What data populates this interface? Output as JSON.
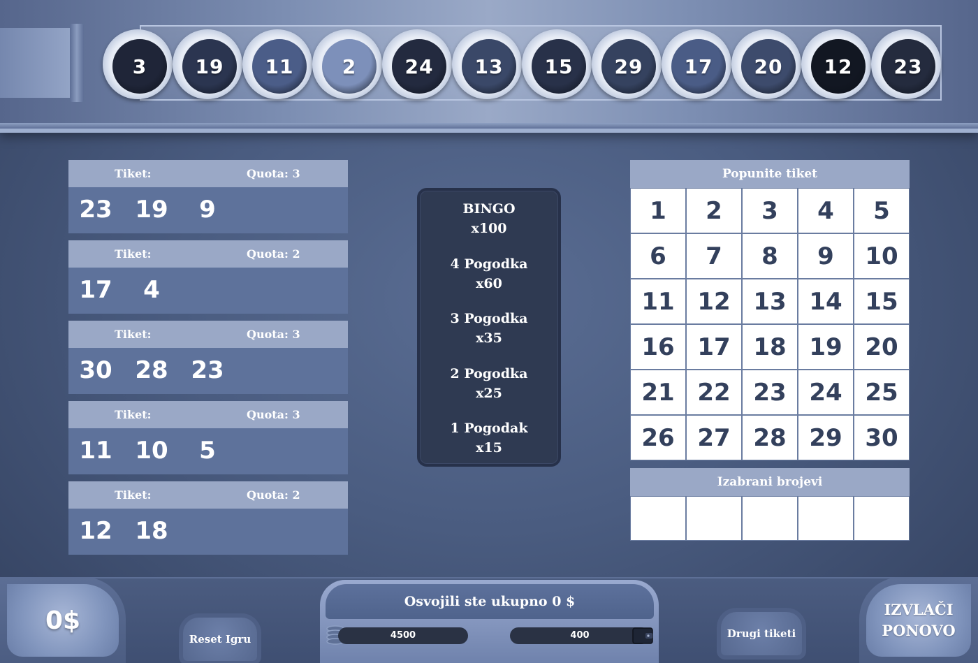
{
  "drawn_balls": [
    {
      "number": "3",
      "color": "#1f2538"
    },
    {
      "number": "19",
      "color": "#2b3550"
    },
    {
      "number": "11",
      "color": "#4b5d88"
    },
    {
      "number": "2",
      "color": "#7d90ba"
    },
    {
      "number": "24",
      "color": "#232a3f"
    },
    {
      "number": "13",
      "color": "#3a4868"
    },
    {
      "number": "15",
      "color": "#283149"
    },
    {
      "number": "29",
      "color": "#35425f"
    },
    {
      "number": "17",
      "color": "#4a5c86"
    },
    {
      "number": "20",
      "color": "#3d4b6c"
    },
    {
      "number": "12",
      "color": "#121722"
    },
    {
      "number": "23",
      "color": "#242b3e"
    }
  ],
  "tickets": [
    {
      "label": "Tiket:",
      "quota": "Quota: 3",
      "numbers": [
        "23",
        "19",
        "9"
      ]
    },
    {
      "label": "Tiket:",
      "quota": "Quota: 2",
      "numbers": [
        "17",
        "4"
      ]
    },
    {
      "label": "Tiket:",
      "quota": "Quota: 3",
      "numbers": [
        "30",
        "28",
        "23"
      ]
    },
    {
      "label": "Tiket:",
      "quota": "Quota: 3",
      "numbers": [
        "11",
        "10",
        "5"
      ]
    },
    {
      "label": "Tiket:",
      "quota": "Quota: 2",
      "numbers": [
        "12",
        "18"
      ]
    }
  ],
  "payouts": [
    {
      "name": "BINGO",
      "multiplier": "x100"
    },
    {
      "name": "4 Pogodka",
      "multiplier": "x60"
    },
    {
      "name": "3 Pogodka",
      "multiplier": "x35"
    },
    {
      "name": "2 Pogodka",
      "multiplier": "x25"
    },
    {
      "name": "1 Pogodak",
      "multiplier": "x15"
    }
  ],
  "picker": {
    "title": "Popunite tiket",
    "numbers": [
      "1",
      "2",
      "3",
      "4",
      "5",
      "6",
      "7",
      "8",
      "9",
      "10",
      "11",
      "12",
      "13",
      "14",
      "15",
      "16",
      "17",
      "18",
      "19",
      "20",
      "21",
      "22",
      "23",
      "24",
      "25",
      "26",
      "27",
      "28",
      "29",
      "30"
    ]
  },
  "chosen": {
    "title": "Izabrani brojevi",
    "slots": [
      "",
      "",
      "",
      "",
      ""
    ]
  },
  "bottom": {
    "balance": "0$",
    "reset_label": "Reset Igru",
    "win_text": "Osvojili ste ukupno 0 $",
    "credits": "4500",
    "bet": "400",
    "other_tickets_label": "Drugi tiketi",
    "draw_again_line1": "IZVLAČI",
    "draw_again_line2": "PONOVO"
  },
  "icons": {
    "coins": "coins-icon",
    "wallet": "wallet-icon"
  }
}
